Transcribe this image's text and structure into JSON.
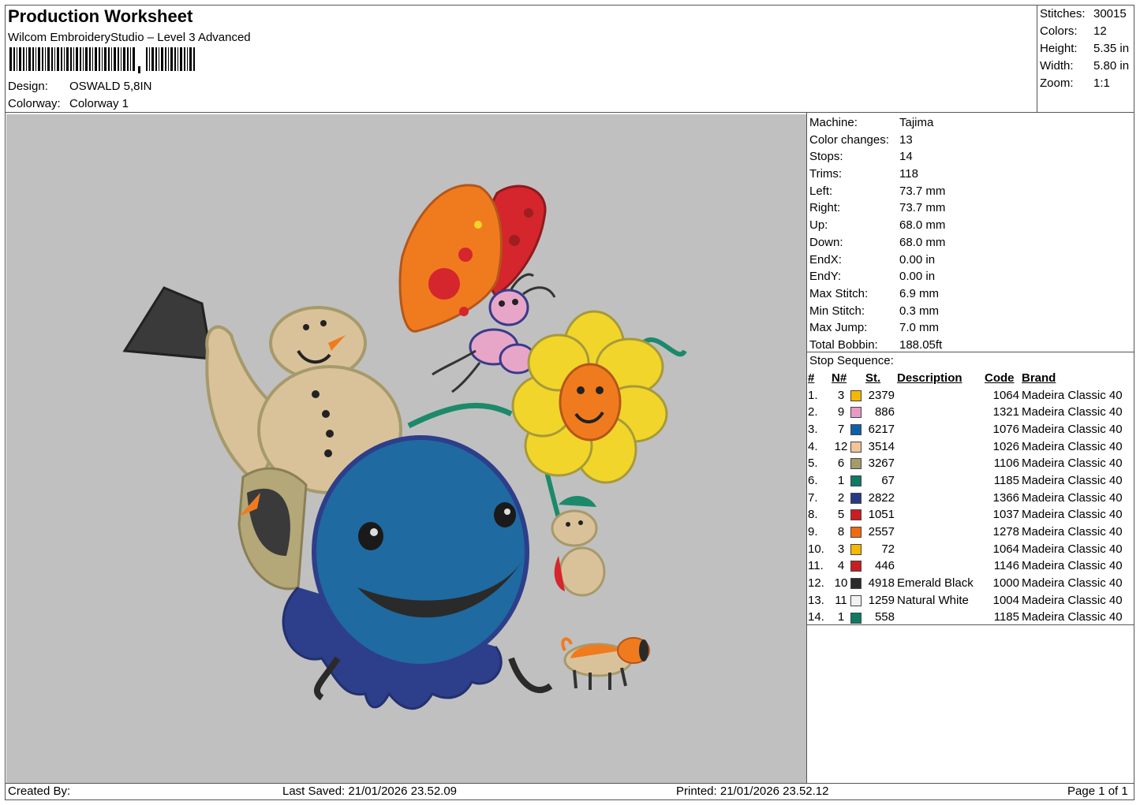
{
  "header": {
    "title": "Production Worksheet",
    "software": "Wilcom EmbroideryStudio – Level 3 Advanced",
    "design_label": "Design:",
    "design_value": "OSWALD 5,8IN",
    "colorway_label": "Colorway:",
    "colorway_value": "Colorway 1"
  },
  "stats": [
    {
      "label": "Stitches:",
      "value": "30015"
    },
    {
      "label": "Colors:",
      "value": "12"
    },
    {
      "label": "Height:",
      "value": "5.35 in"
    },
    {
      "label": "Width:",
      "value": "5.80 in"
    },
    {
      "label": "Zoom:",
      "value": "1:1"
    }
  ],
  "machine_info": [
    {
      "label": "Machine:",
      "value": "Tajima"
    },
    {
      "label": "Color changes:",
      "value": "13"
    },
    {
      "label": "Stops:",
      "value": "14"
    },
    {
      "label": "Trims:",
      "value": "118"
    },
    {
      "label": "Left:",
      "value": "73.7 mm"
    },
    {
      "label": "Right:",
      "value": "73.7 mm"
    },
    {
      "label": "Up:",
      "value": "68.0 mm"
    },
    {
      "label": "Down:",
      "value": "68.0 mm"
    },
    {
      "label": "EndX:",
      "value": "0.00 in"
    },
    {
      "label": "EndY:",
      "value": "0.00 in"
    },
    {
      "label": "Max Stitch:",
      "value": "6.9 mm"
    },
    {
      "label": "Min Stitch:",
      "value": "0.3 mm"
    },
    {
      "label": "Max Jump:",
      "value": "7.0 mm"
    },
    {
      "label": "Total Bobbin:",
      "value": "188.05ft"
    }
  ],
  "stop_sequence": {
    "title": "Stop Sequence:",
    "headers": {
      "idx": "#",
      "needle": "N#",
      "stitches": "St.",
      "description": "Description",
      "code": "Code",
      "brand": "Brand"
    },
    "rows": [
      {
        "idx": "1.",
        "needle": "3",
        "color": "#f5b800",
        "stitches": "2379",
        "description": "",
        "code": "1064",
        "brand": "Madeira Classic 40"
      },
      {
        "idx": "2.",
        "needle": "9",
        "color": "#e79ac3",
        "stitches": "886",
        "description": "",
        "code": "1321",
        "brand": "Madeira Classic 40"
      },
      {
        "idx": "3.",
        "needle": "7",
        "color": "#0f5fa8",
        "stitches": "6217",
        "description": "",
        "code": "1076",
        "brand": "Madeira Classic 40"
      },
      {
        "idx": "4.",
        "needle": "12",
        "color": "#f1c49b",
        "stitches": "3514",
        "description": "",
        "code": "1026",
        "brand": "Madeira Classic 40"
      },
      {
        "idx": "5.",
        "needle": "6",
        "color": "#a69a6b",
        "stitches": "3267",
        "description": "",
        "code": "1106",
        "brand": "Madeira Classic 40"
      },
      {
        "idx": "6.",
        "needle": "1",
        "color": "#0e7a62",
        "stitches": "67",
        "description": "",
        "code": "1185",
        "brand": "Madeira Classic 40"
      },
      {
        "idx": "7.",
        "needle": "2",
        "color": "#283a86",
        "stitches": "2822",
        "description": "",
        "code": "1366",
        "brand": "Madeira Classic 40"
      },
      {
        "idx": "8.",
        "needle": "5",
        "color": "#c81e22",
        "stitches": "1051",
        "description": "",
        "code": "1037",
        "brand": "Madeira Classic 40"
      },
      {
        "idx": "9.",
        "needle": "8",
        "color": "#f06a12",
        "stitches": "2557",
        "description": "",
        "code": "1278",
        "brand": "Madeira Classic 40"
      },
      {
        "idx": "10.",
        "needle": "3",
        "color": "#f5b800",
        "stitches": "72",
        "description": "",
        "code": "1064",
        "brand": "Madeira Classic 40"
      },
      {
        "idx": "11.",
        "needle": "4",
        "color": "#c81e22",
        "stitches": "446",
        "description": "",
        "code": "1146",
        "brand": "Madeira Classic 40"
      },
      {
        "idx": "12.",
        "needle": "10",
        "color": "#2b2b2b",
        "stitches": "4918",
        "description": "Emerald Black",
        "code": "1000",
        "brand": "Madeira Classic 40"
      },
      {
        "idx": "13.",
        "needle": "11",
        "color": "#f2f2f2",
        "stitches": "1259",
        "description": "Natural White",
        "code": "1004",
        "brand": "Madeira Classic 40"
      },
      {
        "idx": "14.",
        "needle": "1",
        "color": "#0e7a62",
        "stitches": "558",
        "description": "",
        "code": "1185",
        "brand": "Madeira Classic 40"
      }
    ]
  },
  "footer": {
    "created_by": "Created By:",
    "last_saved": "Last Saved: 21/01/2026 23.52.09",
    "printed": "Printed: 21/01/2026 23.52.12",
    "page": "Page 1 of 1"
  },
  "canvas": {
    "background": "#c0c0c0",
    "design_colors": {
      "blue": "#1f6aa0",
      "dark_blue": "#2d3e8a",
      "tan": "#d9c29a",
      "olive": "#b4a778",
      "yellow": "#f2d52a",
      "orange": "#f07b1f",
      "red": "#d4262c",
      "pink": "#e7a6c8",
      "green": "#1c8a6a",
      "black": "#2e2e2e"
    }
  }
}
